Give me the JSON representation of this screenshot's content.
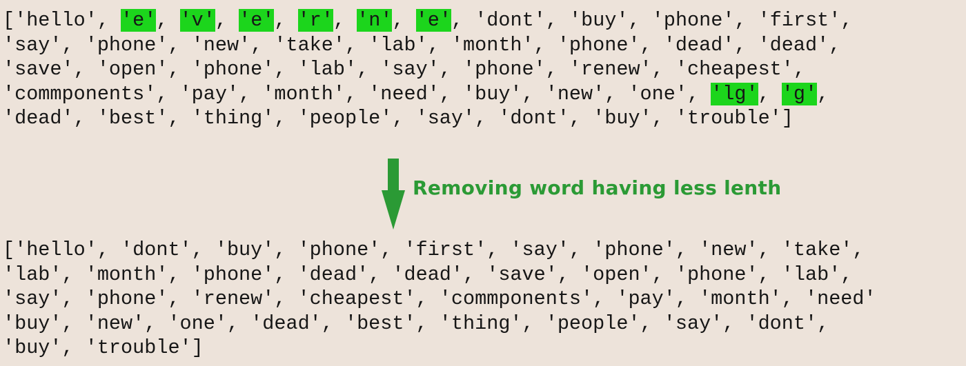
{
  "before_block": {
    "lines": [
      [
        {
          "t": "['hello', ",
          "hl": false
        },
        {
          "t": "'e'",
          "hl": true
        },
        {
          "t": ", ",
          "hl": false
        },
        {
          "t": "'v'",
          "hl": true
        },
        {
          "t": ", ",
          "hl": false
        },
        {
          "t": "'e'",
          "hl": true
        },
        {
          "t": ", ",
          "hl": false
        },
        {
          "t": "'r'",
          "hl": true
        },
        {
          "t": ", ",
          "hl": false
        },
        {
          "t": "'n'",
          "hl": true
        },
        {
          "t": ", ",
          "hl": false
        },
        {
          "t": "'e'",
          "hl": true
        },
        {
          "t": ", 'dont', 'buy', 'phone', 'first',",
          "hl": false
        }
      ],
      [
        {
          "t": "'say', 'phone', 'new', 'take', 'lab', 'month', 'phone', 'dead', 'dead',",
          "hl": false
        }
      ],
      [
        {
          "t": "'save', 'open', 'phone', 'lab', 'say', 'phone', 'renew', 'cheapest',",
          "hl": false
        }
      ],
      [
        {
          "t": "'commponents', 'pay', 'month', 'need', 'buy', 'new', 'one', ",
          "hl": false
        },
        {
          "t": "'lg'",
          "hl": true
        },
        {
          "t": ", ",
          "hl": false
        },
        {
          "t": "'g'",
          "hl": true
        },
        {
          "t": ",",
          "hl": false
        }
      ],
      [
        {
          "t": "'dead', 'best', 'thing', 'people', 'say', 'dont', 'buy', 'trouble']",
          "hl": false
        }
      ]
    ]
  },
  "caption": "Removing word having less lenth",
  "after_block": {
    "lines": [
      "['hello', 'dont', 'buy', 'phone', 'first', 'say', 'phone', 'new', 'take',",
      "'lab', 'month', 'phone', 'dead', 'dead', 'save', 'open', 'phone', 'lab',",
      "'say', 'phone', 'renew', 'cheapest', 'commponents', 'pay', 'month', 'need'",
      "'buy', 'new', 'one', 'dead', 'best', 'thing', 'people', 'say', 'dont',",
      "'buy', 'trouble']"
    ]
  },
  "colors": {
    "background": "#ede3da",
    "highlight": "#1cd51c",
    "arrow": "#2b9a35",
    "caption": "#2b9a35",
    "text": "#161616"
  },
  "icons": {
    "arrow": "down-arrow-icon"
  }
}
